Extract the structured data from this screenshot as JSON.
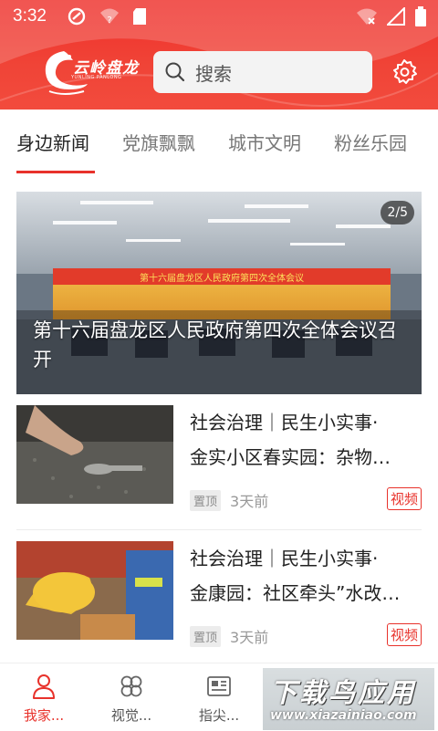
{
  "status_bar": {
    "time": "3:32"
  },
  "header": {
    "logo_text": "云岭盘龙",
    "logo_sub": "YUNLING PANLONG",
    "search_placeholder": "搜索",
    "accent_color": "#ef2f2b"
  },
  "tabs": [
    {
      "label": "身边新闻",
      "active": true
    },
    {
      "label": "党旗飘飘",
      "active": false
    },
    {
      "label": "城市文明",
      "active": false
    },
    {
      "label": "粉丝乐园",
      "active": false
    }
  ],
  "hero": {
    "badge": "2/5",
    "banner_text": "第十六届盘龙区人民政府第四次全体会议",
    "title": "第十六届盘龙区人民政府第四次全体会议召开"
  },
  "news": [
    {
      "title_line1": "社会治理｜民生小实事·",
      "title_line2": "金实小区春实园：杂物…",
      "pin": "置顶",
      "time": "3天前",
      "tag": "视频"
    },
    {
      "title_line1": "社会治理｜民生小实事·",
      "title_line2": "金康园：社区牵头”水改…",
      "pin": "置顶",
      "time": "3天前",
      "tag": "视频"
    }
  ],
  "bottom_nav": [
    {
      "label": "我家...",
      "icon": "person-icon",
      "active": true
    },
    {
      "label": "视觉...",
      "icon": "flower-icon",
      "active": false
    },
    {
      "label": "指尖...",
      "icon": "newspaper-icon",
      "active": false
    }
  ],
  "watermark": {
    "big": "下载鸟应用",
    "small": "www.xiazainiao.com"
  }
}
